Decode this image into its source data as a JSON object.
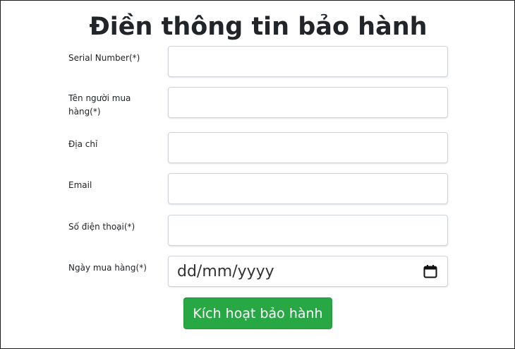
{
  "form": {
    "title": "Điền thông tin bảo hành",
    "fields": [
      {
        "label": "Serial Number(*)",
        "value": ""
      },
      {
        "label": "Tên người mua hàng(*)",
        "value": ""
      },
      {
        "label": "Địa chỉ",
        "value": ""
      },
      {
        "label": "Email",
        "value": ""
      },
      {
        "label": "Số điện thoại(*)",
        "value": ""
      },
      {
        "label": "Ngày mua hàng(*)",
        "placeholder": "dd/mm/yyyy",
        "icon": "calendar-icon"
      }
    ],
    "submit_label": "Kích hoạt bảo hành"
  },
  "colors": {
    "button_bg": "#28a745",
    "button_text": "#ffffff",
    "input_border": "#ced4da"
  }
}
